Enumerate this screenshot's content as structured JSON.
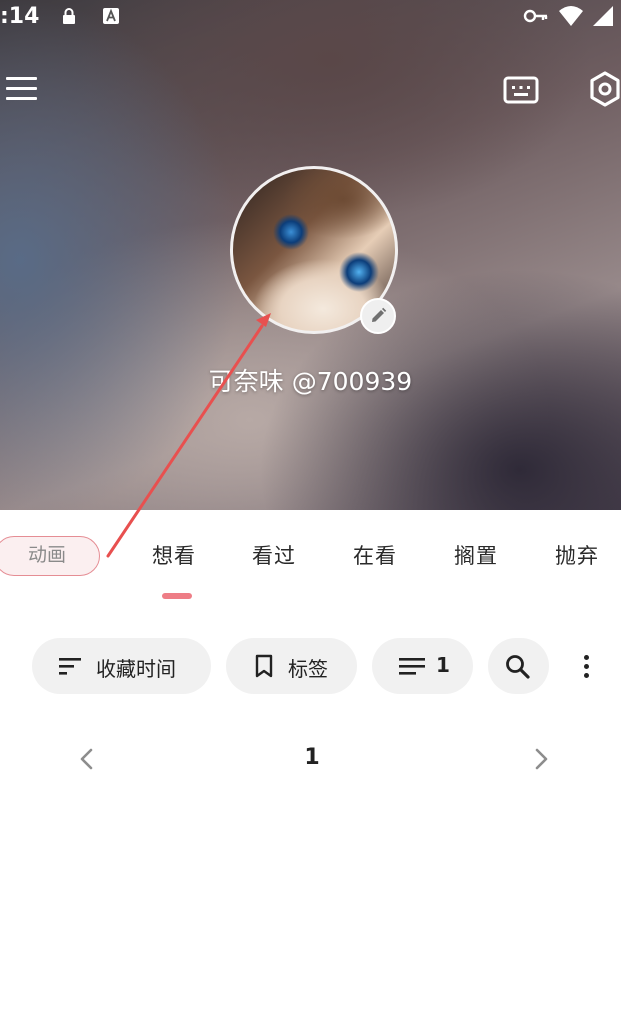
{
  "status_bar": {
    "time": ":14",
    "icons": [
      "lock-icon",
      "app-a-icon",
      "vpn-key-icon",
      "wifi-icon",
      "signal-icon"
    ]
  },
  "toolbar": {
    "menu_icon": "menu-icon",
    "keyboard_icon": "keyboard-icon",
    "settings_icon": "gear-icon"
  },
  "profile": {
    "username": "可奈味 @700939",
    "avatar_edit_icon": "pencil-icon"
  },
  "category": {
    "label": "动画",
    "accent": "#e58d94"
  },
  "tabs": [
    {
      "label": "想看",
      "active": true
    },
    {
      "label": "看过",
      "active": false
    },
    {
      "label": "在看",
      "active": false
    },
    {
      "label": "搁置",
      "active": false
    },
    {
      "label": "抛弃",
      "active": false
    }
  ],
  "filters": {
    "sort_label": "收藏时间",
    "tag_label": "标签",
    "layout_label": "1"
  },
  "pagination": {
    "current": "1"
  },
  "colors": {
    "accent": "#ee7d86",
    "chip_bg": "#f1f1f1"
  }
}
